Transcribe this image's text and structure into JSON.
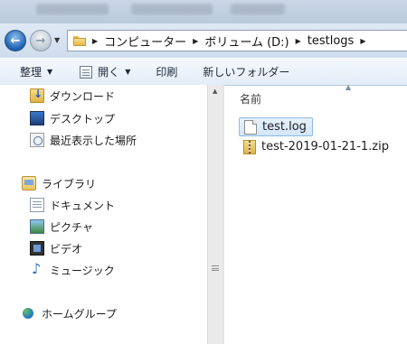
{
  "address_bar": {
    "breadcrumbs": [
      "コンピューター",
      "ボリューム (D:)",
      "testlogs"
    ]
  },
  "toolbar": {
    "organize_label": "整理",
    "open_label": "開く",
    "print_label": "印刷",
    "new_folder_label": "新しいフォルダー"
  },
  "nav_pane": {
    "favorites": [
      {
        "label": "ダウンロード",
        "icon": "download-folder-icon"
      },
      {
        "label": "デスクトップ",
        "icon": "desktop-icon"
      },
      {
        "label": "最近表示した場所",
        "icon": "recent-places-icon"
      }
    ],
    "libraries": {
      "label": "ライブラリ",
      "items": [
        {
          "label": "ドキュメント",
          "icon": "documents-icon"
        },
        {
          "label": "ピクチャ",
          "icon": "pictures-icon"
        },
        {
          "label": "ビデオ",
          "icon": "videos-icon"
        },
        {
          "label": "ミュージック",
          "icon": "music-icon"
        }
      ]
    },
    "homegroup": {
      "label": "ホームグループ",
      "icon": "homegroup-icon"
    }
  },
  "content": {
    "column_header": "名前",
    "files": [
      {
        "name": "test.log",
        "icon": "text-file-icon",
        "selected": true
      },
      {
        "name": "test-2019-01-21-1.zip",
        "icon": "zip-file-icon",
        "selected": false
      }
    ]
  }
}
